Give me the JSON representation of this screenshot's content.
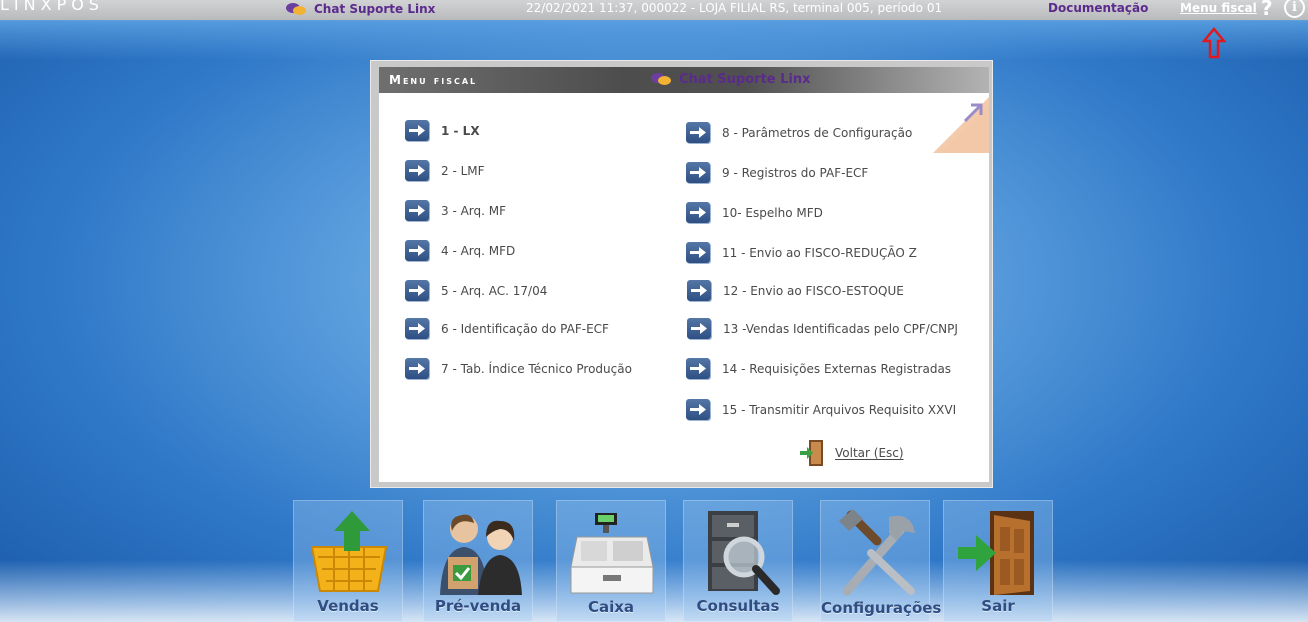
{
  "topbar": {
    "logo": "LINXPOS",
    "chat": "Chat Suporte Linx",
    "status": "22/02/2021 11:37, 000022 - LOJA FILIAL RS, terminal 005, período 01",
    "documentation": "Documentação",
    "menu_fiscal": "Menu fiscal",
    "help": "?",
    "info": "i"
  },
  "panel": {
    "title": "Menu fiscal",
    "chat": "Chat Suporte Linx",
    "left_items": [
      {
        "label": "1 - LX"
      },
      {
        "label": "2 - LMF"
      },
      {
        "label": "3 - Arq. MF"
      },
      {
        "label": "4 - Arq. MFD"
      },
      {
        "label": "5 - Arq. AC. 17/04"
      },
      {
        "label": "6 - Identificação do PAF-ECF"
      },
      {
        "label": "7 - Tab. Índice Técnico Produção"
      }
    ],
    "right_items": [
      {
        "label": "8 - Parâmetros de Configuração"
      },
      {
        "label": "9 - Registros do PAF-ECF"
      },
      {
        "label": "10- Espelho MFD"
      },
      {
        "label": "11 - Envio ao FISCO-REDUÇÃO Z"
      },
      {
        "label": "12 - Envio ao FISCO-ESTOQUE"
      },
      {
        "label": "13 -Vendas Identificadas pelo CPF/CNPJ"
      },
      {
        "label": "14 - Requisições Externas Registradas"
      },
      {
        "label": "15 - Transmitir Arquivos Requisito XXVI"
      }
    ],
    "back": "Voltar (Esc)"
  },
  "dock": {
    "vendas": "Vendas",
    "prevenda": "Pré-venda",
    "caixa": "Caixa",
    "consultas": "Consultas",
    "configuracoes": "Configurações",
    "sair": "Sair"
  }
}
